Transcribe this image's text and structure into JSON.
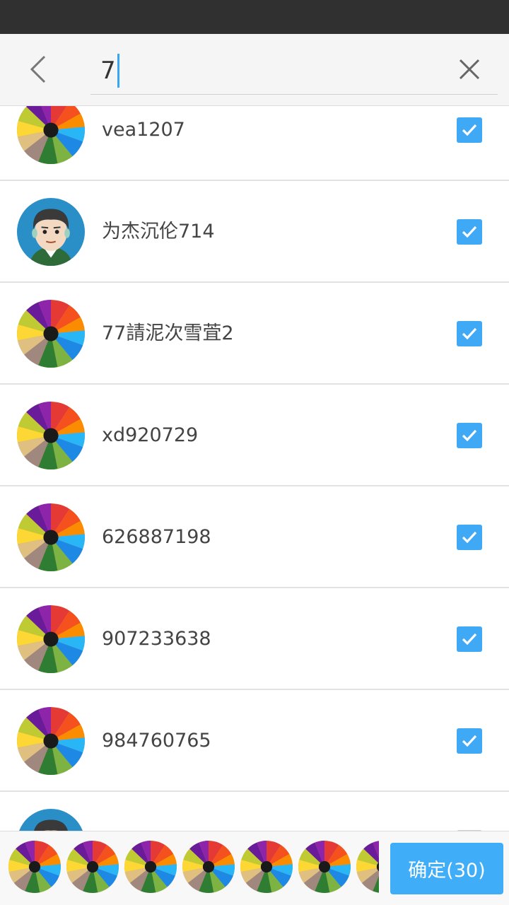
{
  "search": {
    "query": "7"
  },
  "contacts": [
    {
      "name": "vea1207",
      "avatar": "pencils-avatar",
      "checked": true
    },
    {
      "name": "为杰沉伦714",
      "avatar": "cartoon-man-avatar",
      "checked": true
    },
    {
      "name": "77請泥次雪萓2",
      "avatar": "pencils-avatar",
      "checked": true
    },
    {
      "name": "xd920729",
      "avatar": "pencils-avatar",
      "checked": true
    },
    {
      "name": "626887198",
      "avatar": "pencils-avatar",
      "checked": true
    },
    {
      "name": "907233638",
      "avatar": "pencils-avatar",
      "checked": true
    },
    {
      "name": "984760765",
      "avatar": "pencils-avatar",
      "checked": true
    },
    {
      "name": "",
      "avatar": "cartoon-man-avatar",
      "checked": false
    }
  ],
  "footer": {
    "confirm_label": "确定(30)",
    "selected_avatars": [
      "pencils-avatar",
      "pencils-avatar",
      "pencils-avatar",
      "pencils-avatar",
      "pencils-avatar",
      "pencils-avatar",
      "pencils-avatar"
    ]
  },
  "colors": {
    "accent": "#3fa9f5",
    "status_bar": "#303030",
    "header_bg": "#f5f5f5"
  }
}
